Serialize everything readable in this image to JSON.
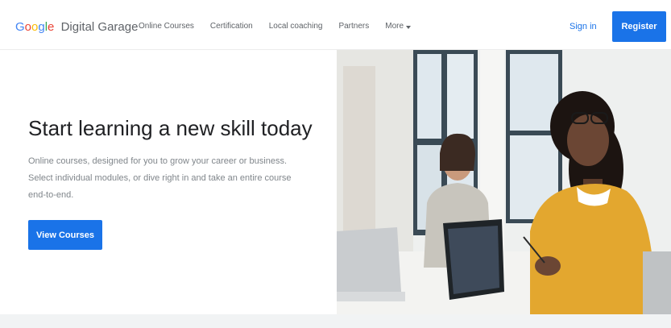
{
  "brand": {
    "google_letters": [
      {
        "ch": "G",
        "color": "#4285F4"
      },
      {
        "ch": "o",
        "color": "#EA4335"
      },
      {
        "ch": "o",
        "color": "#FBBC05"
      },
      {
        "ch": "g",
        "color": "#4285F4"
      },
      {
        "ch": "l",
        "color": "#34A853"
      },
      {
        "ch": "e",
        "color": "#EA4335"
      }
    ],
    "sub": "Digital Garage"
  },
  "nav": {
    "links": [
      "Online Courses",
      "Certification",
      "Local coaching",
      "Partners"
    ],
    "more_label": "More",
    "more_icon": "caret-down-icon"
  },
  "auth": {
    "signin_label": "Sign in",
    "register_label": "Register"
  },
  "hero": {
    "headline": "Start learning a new skill today",
    "description": "Online courses, designed for you to grow your career or business. Select individual modules, or dive right in and take an entire course end-to-end.",
    "cta_label": "View Courses"
  },
  "colors": {
    "accent": "#1a73e8",
    "text_primary": "#202124",
    "text_secondary": "#80868b",
    "footer_strip": "#f1f3f4"
  }
}
